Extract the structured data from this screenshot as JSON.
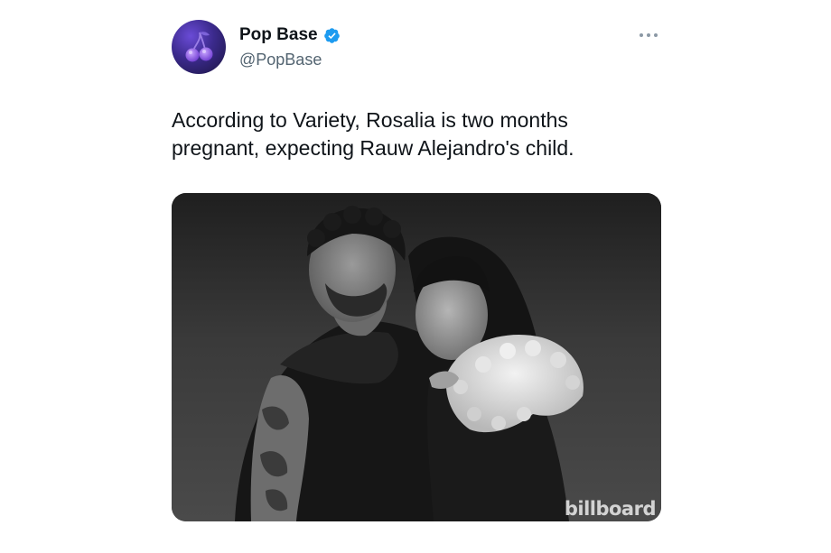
{
  "tweet": {
    "display_name": "Pop Base",
    "handle": "@PopBase",
    "text": "According to Variety, Rosalia is two months pregnant, expecting Rauw Alejandro's child.",
    "verified": true,
    "avatar_icon": "cherry-icon",
    "more_icon": "more-options-icon",
    "media": {
      "description_icon": "photo",
      "watermark": "billboard"
    }
  },
  "colors": {
    "verified_blue": "#1d9bf0",
    "text_primary": "#0f1419",
    "text_secondary": "#536471",
    "avatar_purple": "#3b2a8c"
  }
}
